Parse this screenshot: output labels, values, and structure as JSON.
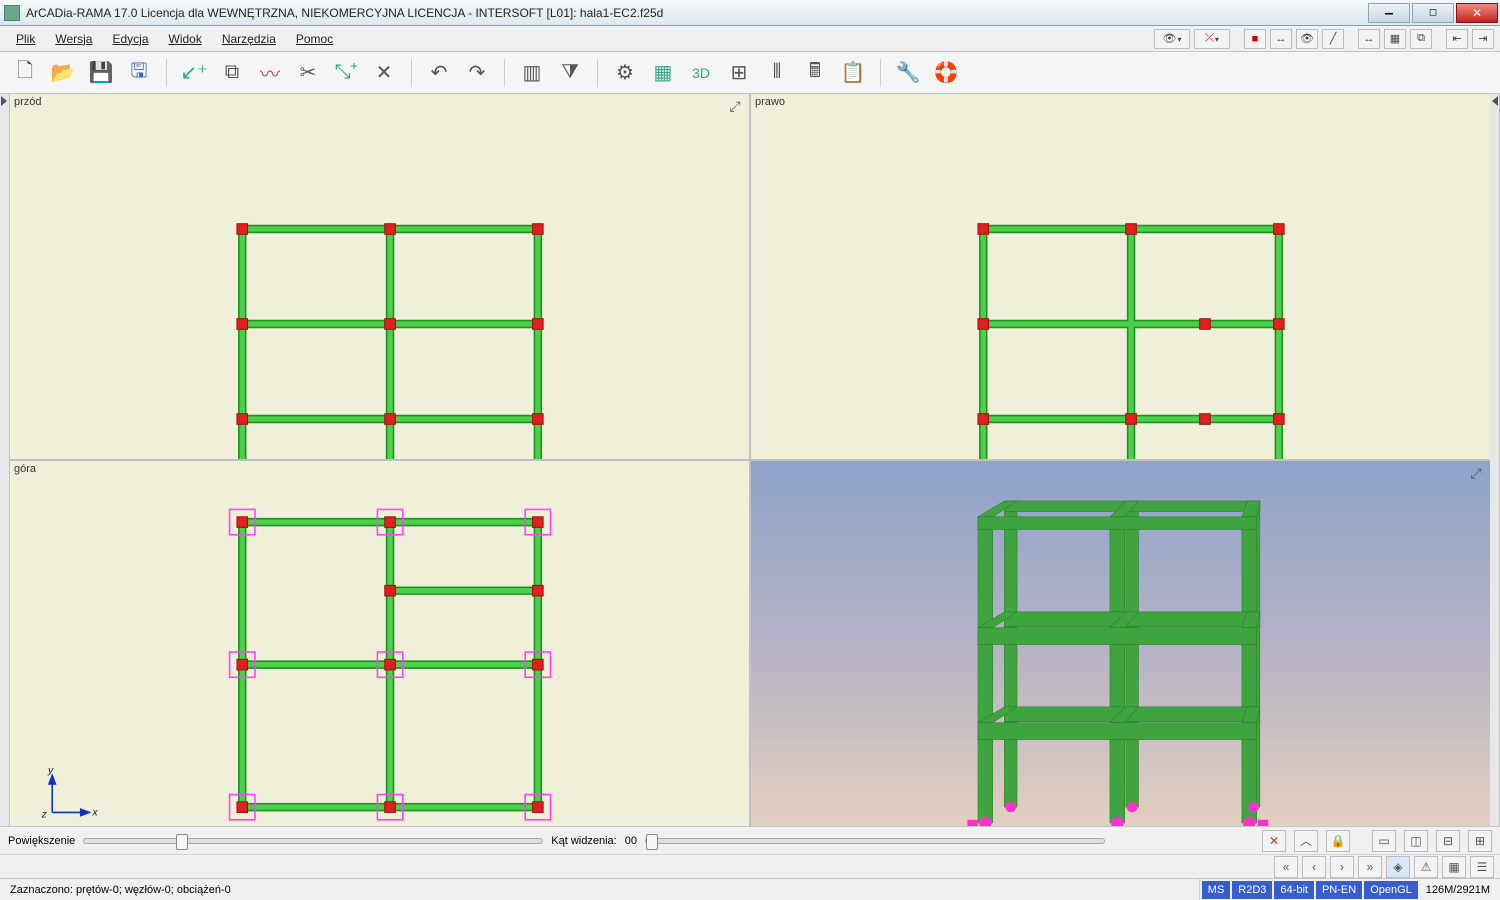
{
  "window": {
    "title": "ArCADia-RAMA 17.0 Licencja dla WEWNĘTRZNA, NIEKOMERCYJNA LICENCJA - INTERSOFT [L01]: hala1-EC2.f25d"
  },
  "menu": {
    "file": "Plik",
    "version": "Wersja",
    "edit": "Edycja",
    "view": "Widok",
    "tools": "Narzędzia",
    "help": "Pomoc"
  },
  "viewports": {
    "front": "przód",
    "right": "prawo",
    "top": "góra"
  },
  "axes": {
    "x": "x",
    "y": "y",
    "z": "z"
  },
  "bottom": {
    "zoom_label": "Powiększenie",
    "fov_label": "Kąt widzenia:",
    "fov_value": "00"
  },
  "status": {
    "selection": "Zaznaczono: prętów-0; węzłów-0; obciążeń-0",
    "tags": [
      "MS",
      "R2D3",
      "64-bit",
      "PN-EN",
      "OpenGL"
    ],
    "memory": "126M/2921M"
  },
  "colors": {
    "beam": "#4bd04b",
    "beam_stroke": "#209020",
    "node": "#e02020",
    "support": "#ff40ff",
    "viewbg": "#f0efd9"
  }
}
